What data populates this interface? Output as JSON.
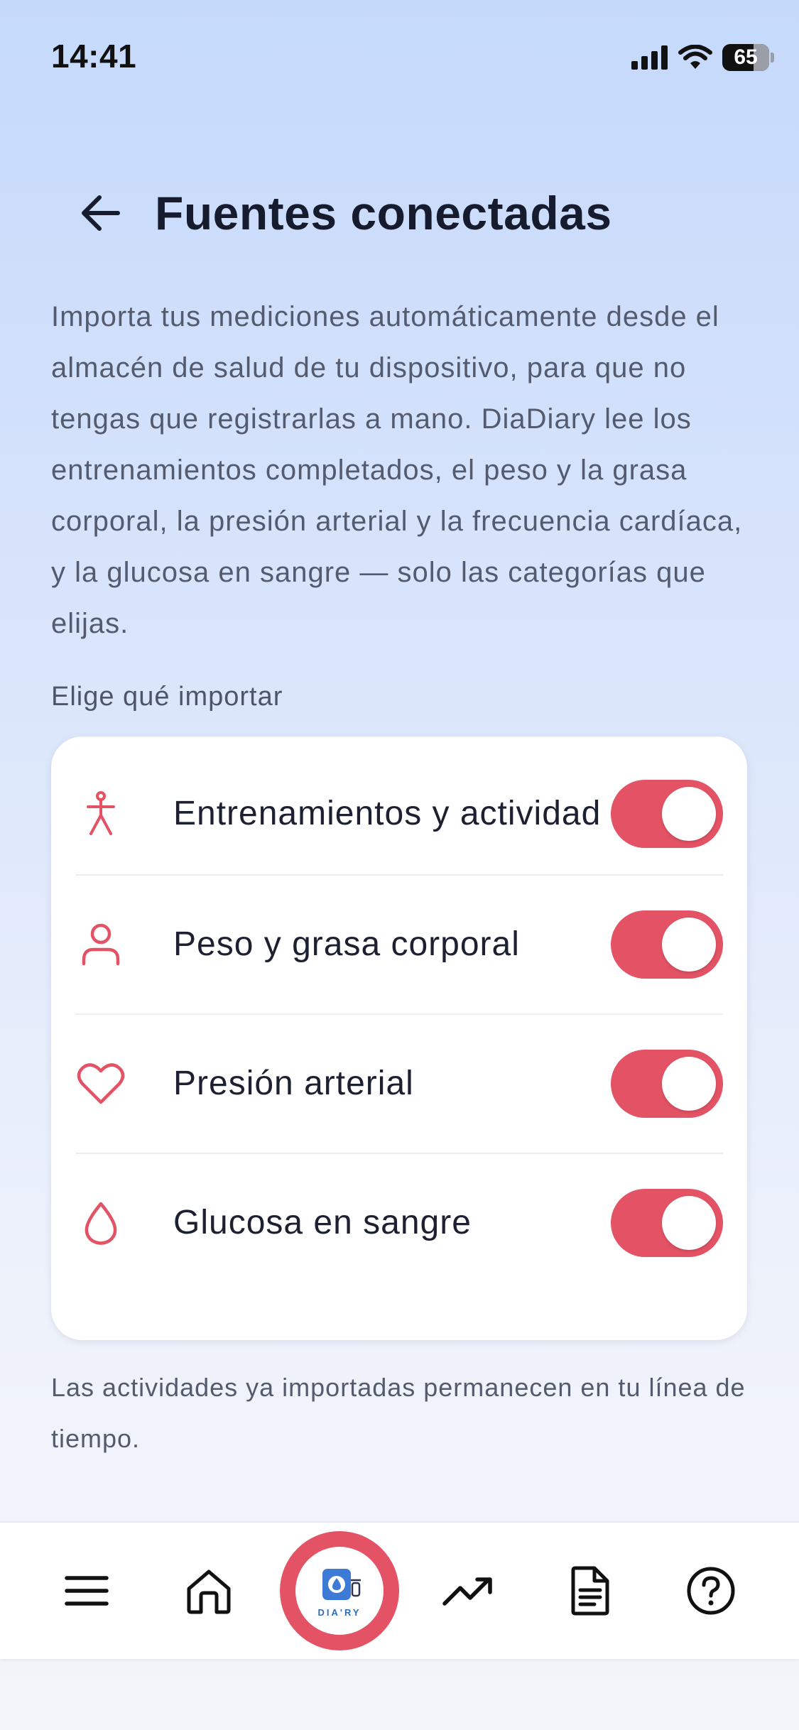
{
  "status": {
    "time": "14:41",
    "battery": "65"
  },
  "header": {
    "title": "Fuentes conectadas"
  },
  "intro": "Importa tus mediciones automáticamente desde el almacén de salud de tu dispositivo, para que no tengas que registrarlas a mano. DiaDiary lee los entrenamientos completados, el peso y la grasa corporal, la presión arterial y la frecuencia cardíaca, y la glucosa en sangre — solo las categorías que elijas.",
  "section_label": "Elige qué importar",
  "sources": [
    {
      "label": "Entrenamientos y actividad",
      "icon": "person-activity-icon",
      "enabled": true
    },
    {
      "label": "Peso y grasa corporal",
      "icon": "person-icon",
      "enabled": true
    },
    {
      "label": "Presión arterial",
      "icon": "heart-icon",
      "enabled": true
    },
    {
      "label": "Glucosa en sangre",
      "icon": "drop-icon",
      "enabled": true
    }
  ],
  "footnote": "Las actividades ya importadas permanecen en tu línea de tiempo.",
  "nav": {
    "items": [
      "menu-icon",
      "home-icon",
      "diary-logo",
      "trend-icon",
      "document-icon",
      "help-icon"
    ],
    "logo_text": "DIA'RY"
  },
  "colors": {
    "accent": "#e35365",
    "title": "#161b2e",
    "body_text": "#545b6e",
    "background_top": "#c5d9fb"
  }
}
